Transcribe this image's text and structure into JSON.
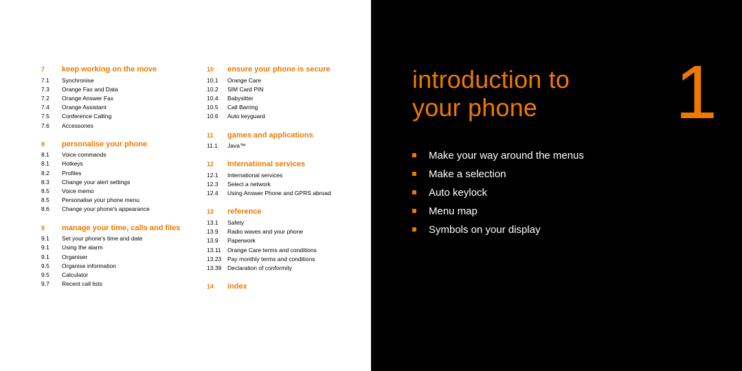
{
  "colors": {
    "accent": "#f07800",
    "bg_dark": "#000000",
    "bg_light": "#ffffff"
  },
  "left": {
    "col1": {
      "sections": [
        {
          "num": "7",
          "heading": "keep working on the move",
          "items": [
            {
              "n": "7.1",
              "t": "Synchronise"
            },
            {
              "n": "7.3",
              "t": "Orange Fax and Data"
            },
            {
              "n": "7.2",
              "t": "Orange Answer Fax"
            },
            {
              "n": "7.4",
              "t": "Orange Assistant"
            },
            {
              "n": "7.5",
              "t": "Conference Calling"
            },
            {
              "n": "7.6",
              "t": "Accessories"
            }
          ]
        },
        {
          "num": "8",
          "heading": "personalise your phone",
          "items": [
            {
              "n": "8.1",
              "t": "Voice commands"
            },
            {
              "n": "8.1",
              "t": "Hotkeys"
            },
            {
              "n": "8.2",
              "t": "Profiles"
            },
            {
              "n": "8.3",
              "t": "Change your alert settings"
            },
            {
              "n": "8.5",
              "t": "Voice memo"
            },
            {
              "n": "8.5",
              "t": "Personalise your phone menu"
            },
            {
              "n": "8.6",
              "t": "Change your phone's appearance"
            }
          ]
        },
        {
          "num": "9",
          "heading": "manage your time, calls and files",
          "items": [
            {
              "n": "9.1",
              "t": "Set your phone's time and date"
            },
            {
              "n": "9.1",
              "t": "Using the alarm"
            },
            {
              "n": "9.1",
              "t": "Organiser"
            },
            {
              "n": "9.5",
              "t": "Organise information"
            },
            {
              "n": "9.5",
              "t": "Calculator"
            },
            {
              "n": "9.7",
              "t": "Recent call lists"
            }
          ]
        }
      ]
    },
    "col2": {
      "sections": [
        {
          "num": "10",
          "heading": "ensure your phone is secure",
          "items": [
            {
              "n": "10.1",
              "t": "Orange Care"
            },
            {
              "n": "10.2",
              "t": "SIM Card PIN"
            },
            {
              "n": "10.4",
              "t": "Babysitter"
            },
            {
              "n": "10.5",
              "t": "Call Barring"
            },
            {
              "n": "10.6",
              "t": "Auto keyguard"
            }
          ]
        },
        {
          "num": "11",
          "heading": "games and applications",
          "items": []
        },
        {
          "num": "12",
          "heading": "International services",
          "items": [
            {
              "n": "12.1",
              "t": "International services"
            },
            {
              "n": "12.3",
              "t": "Select a network"
            },
            {
              "n": "12.4",
              "t": "Using Answer Phone and GPRS abroad"
            }
          ]
        },
        {
          "num": "13",
          "heading": "reference",
          "items": [
            {
              "n": "13.1",
              "t": "Safety"
            },
            {
              "n": "13.9",
              "t": "Radio waves and your phone"
            },
            {
              "n": "13.9",
              "t": "Paperwork"
            },
            {
              "n": "13.11",
              "t": "Orange Care terms and conditions"
            },
            {
              "n": "13.23",
              "t": "Pay monthly terms and conditions"
            },
            {
              "n": "13.39",
              "t": "Declaration of conformity"
            }
          ]
        },
        {
          "num": "14",
          "heading": "index",
          "items": []
        }
      ],
      "java_row": {
        "n": "11.1",
        "t": "Java™"
      }
    }
  },
  "right": {
    "chapter_number": "1",
    "title_line1": "introduction to",
    "title_line2": "your phone",
    "bullets": [
      "Make your way around the menus",
      "Make a selection",
      "Auto keylock",
      "Menu map",
      "Symbols on your display"
    ]
  }
}
